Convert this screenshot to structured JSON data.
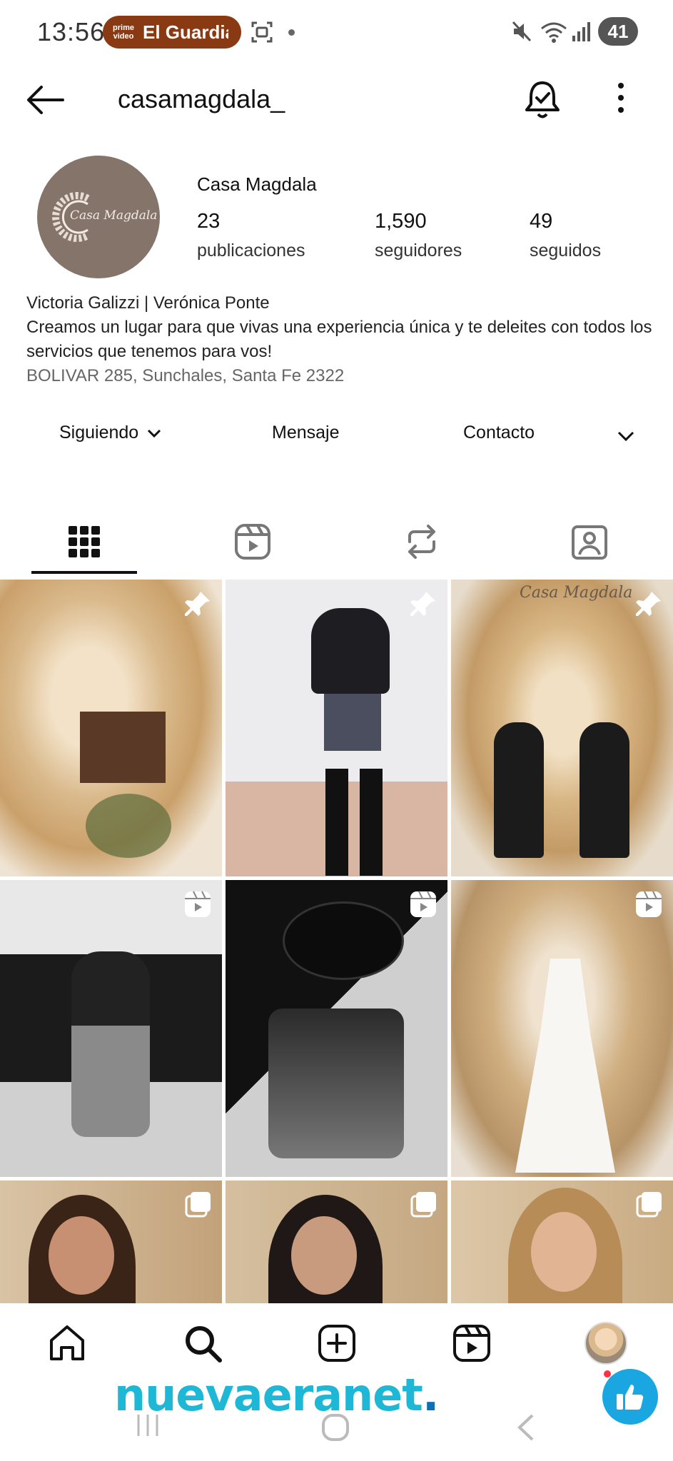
{
  "status_bar": {
    "time": "13:56",
    "pill_logo": "prime video",
    "pill_text": "El Guardián",
    "battery": "41",
    "icons": [
      "screenshot-icon",
      "mute-icon",
      "wifi-icon",
      "signal-icon"
    ]
  },
  "header": {
    "username": "casamagdala_",
    "icons": [
      "back-arrow-icon",
      "bell-check-icon",
      "more-vertical-icon"
    ]
  },
  "profile": {
    "avatar_text": "Casa Magdala",
    "display_name": "Casa Magdala",
    "stats": [
      {
        "value": "23",
        "label": "publicaciones"
      },
      {
        "value": "1,590",
        "label": "seguidores"
      },
      {
        "value": "49",
        "label": "seguidos"
      }
    ],
    "bio_line1": "Victoria Galizzi | Verónica Ponte",
    "bio_line2": "Creamos un lugar para que vivas una experiencia única y te deleites con todos los servicios que tenemos para vos!",
    "address": "BOLIVAR  285, Sunchales, Santa Fe 2322"
  },
  "actions": {
    "following": "Siguiendo",
    "message": "Mensaje",
    "contact": "Contacto"
  },
  "tabs": [
    "grid-icon",
    "reels-icon",
    "reposts-icon",
    "tagged-icon"
  ],
  "grid": [
    {
      "name": "post-pampas-desk",
      "badge": "pin-icon"
    },
    {
      "name": "post-black-outfit",
      "badge": "pin-icon"
    },
    {
      "name": "post-two-women-seated",
      "badge": "pin-icon",
      "overlay_text": "Casa Magdala"
    },
    {
      "name": "post-sequin-jacket",
      "badge": "reel-icon"
    },
    {
      "name": "post-black-hat",
      "badge": "reel-icon"
    },
    {
      "name": "post-white-dress",
      "badge": "reel-icon"
    },
    {
      "name": "post-portrait-1",
      "badge": "carousel-icon"
    },
    {
      "name": "post-portrait-2",
      "badge": "carousel-icon"
    },
    {
      "name": "post-portrait-3",
      "badge": "carousel-icon"
    }
  ],
  "bottom_nav": [
    "home-icon",
    "search-icon",
    "create-icon",
    "reels-icon",
    "profile-avatar"
  ],
  "watermark": {
    "text": "nuevaeranet",
    "dot": "."
  },
  "colors": {
    "accent_pill": "#8a3a12",
    "avatar_bg": "#857469",
    "watermark": "#1fb7d6",
    "notification_dot": "#ff3040"
  }
}
